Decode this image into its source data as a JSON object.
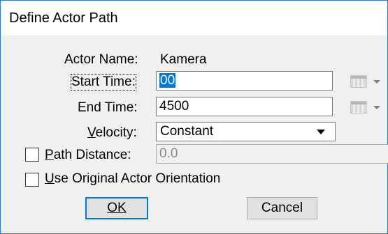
{
  "window": {
    "title": "Define Actor Path"
  },
  "form": {
    "actor_name_label": "Actor Name:",
    "actor_name_value": "Kamera",
    "start_time_label": "Start Time:",
    "start_time_value": "00",
    "end_time_label": "End Time:",
    "end_time_value": "4500",
    "velocity_label": "Velocity:",
    "velocity_value": "Constant",
    "path_distance_label": "Path Distance:",
    "path_distance_value": "0.0",
    "use_original_label": "Use Original Actor Orientation"
  },
  "buttons": {
    "ok": "OK",
    "cancel": "Cancel"
  },
  "colors": {
    "accent": "#0078d7",
    "border": "#2b79d0",
    "dialog_bg": "#f0f0f0"
  },
  "icons": {
    "calendar": "calendar-icon",
    "dropdown": "chevron-down-icon"
  }
}
